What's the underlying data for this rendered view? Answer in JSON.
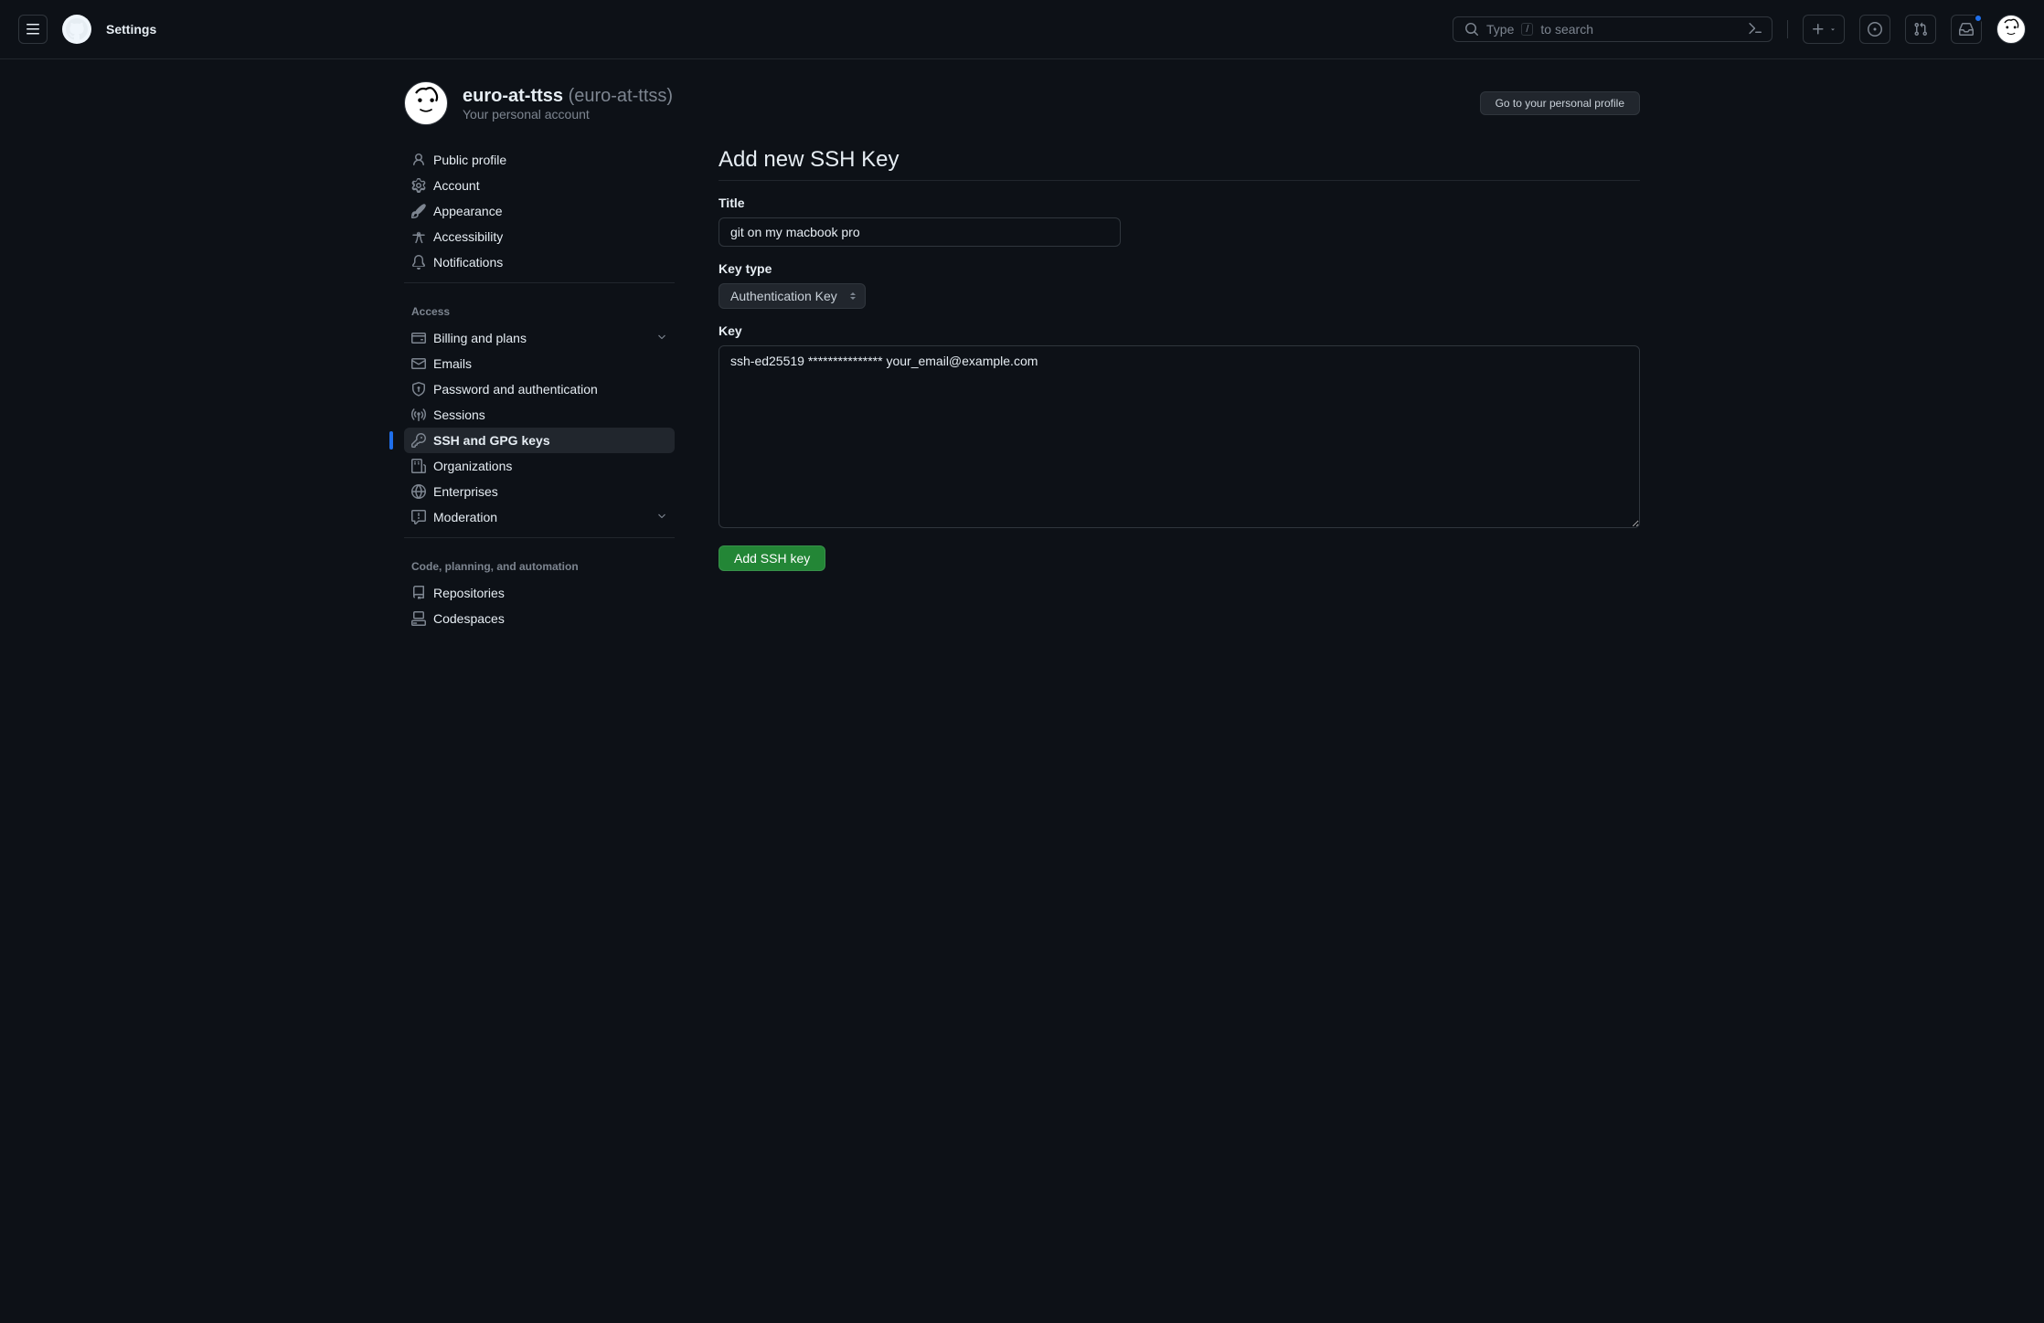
{
  "header": {
    "title": "Settings",
    "search_prefix": "Type",
    "search_suffix": "to search",
    "search_slash": "/"
  },
  "account": {
    "username": "euro-at-ttss",
    "handle": "(euro-at-ttss)",
    "subtitle": "Your personal account",
    "profile_button": "Go to your personal profile"
  },
  "sidebar": {
    "top_items": [
      {
        "label": "Public profile",
        "icon": "person"
      },
      {
        "label": "Account",
        "icon": "gear"
      },
      {
        "label": "Appearance",
        "icon": "paintbrush"
      },
      {
        "label": "Accessibility",
        "icon": "accessibility"
      },
      {
        "label": "Notifications",
        "icon": "bell"
      }
    ],
    "section_access": "Access",
    "access_items": [
      {
        "label": "Billing and plans",
        "icon": "credit-card",
        "chevron": true
      },
      {
        "label": "Emails",
        "icon": "mail"
      },
      {
        "label": "Password and authentication",
        "icon": "shield-lock"
      },
      {
        "label": "Sessions",
        "icon": "broadcast"
      },
      {
        "label": "SSH and GPG keys",
        "icon": "key",
        "active": true
      },
      {
        "label": "Organizations",
        "icon": "organization"
      },
      {
        "label": "Enterprises",
        "icon": "globe"
      },
      {
        "label": "Moderation",
        "icon": "report",
        "chevron": true
      }
    ],
    "section_code": "Code, planning, and automation",
    "code_items": [
      {
        "label": "Repositories",
        "icon": "repo"
      },
      {
        "label": "Codespaces",
        "icon": "codespaces"
      }
    ]
  },
  "page": {
    "heading": "Add new SSH Key",
    "title_label": "Title",
    "title_value": "git on my macbook pro",
    "keytype_label": "Key type",
    "keytype_value": "Authentication Key",
    "key_label": "Key",
    "key_value": "ssh-ed25519 *************** your_email@example.com",
    "submit_label": "Add SSH key"
  }
}
